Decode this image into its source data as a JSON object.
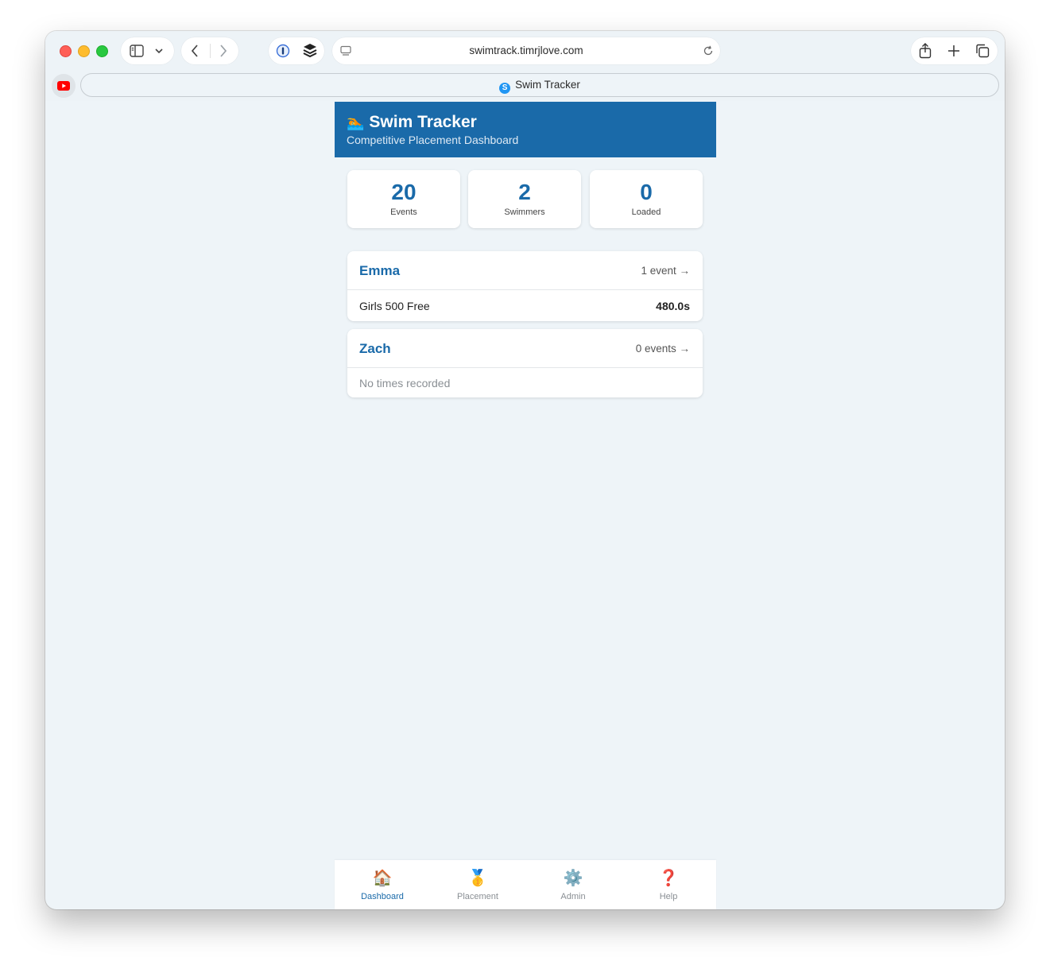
{
  "browser": {
    "url": "swimtrack.timrjlove.com",
    "tab_title": "Swim Tracker",
    "tab_favicon_letter": "S"
  },
  "app": {
    "title": "Swim Tracker",
    "logo_icon": "🏊",
    "subtitle": "Competitive Placement Dashboard",
    "accent_color": "#1a6aa9"
  },
  "stats": [
    {
      "value": "20",
      "label": "Events"
    },
    {
      "value": "2",
      "label": "Swimmers"
    },
    {
      "value": "0",
      "label": "Loaded"
    }
  ],
  "swimmers": [
    {
      "name": "Emma",
      "count": "1 event →",
      "event": "Girls 500 Free",
      "time": "480.0s"
    },
    {
      "name": "Zach",
      "count": "0 events →",
      "empty": "No times recorded"
    }
  ],
  "nav": [
    {
      "icon": "🏠",
      "label": "Dashboard",
      "active": true
    },
    {
      "icon": "🥇",
      "label": "Placement"
    },
    {
      "icon": "⚙️",
      "label": "Admin"
    },
    {
      "icon": "❓",
      "label": "Help"
    }
  ]
}
